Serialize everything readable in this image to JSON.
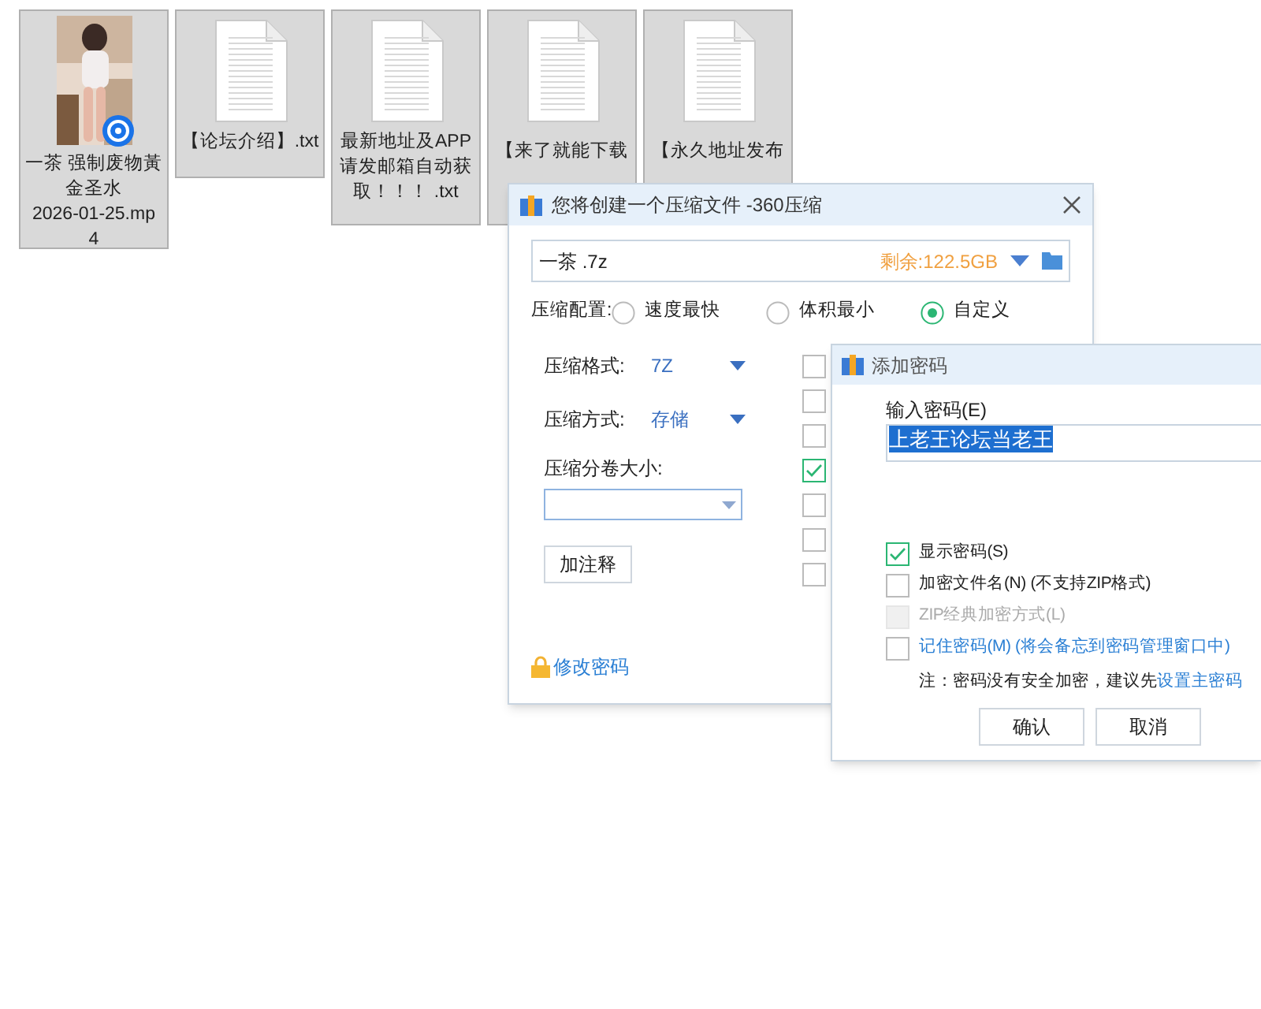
{
  "files": [
    {
      "kind": "video",
      "selected": true,
      "name_lines": [
        "一茶 强制废物黃",
        "金圣水",
        "2026-01-25.mp",
        "4"
      ]
    },
    {
      "kind": "text",
      "selected": true,
      "name_lines": [
        "【论坛介绍】.txt"
      ]
    },
    {
      "kind": "text",
      "selected": true,
      "name_lines": [
        "最新地址及APP",
        "请发邮箱自动获",
        "取！！！ .txt"
      ]
    },
    {
      "kind": "text",
      "selected": true,
      "name_lines": [
        "【来了就能下载"
      ]
    },
    {
      "kind": "text",
      "selected": true,
      "name_lines": [
        "【永久地址发布"
      ]
    }
  ],
  "compress_dialog": {
    "title": "您将创建一个压缩文件 -360压缩",
    "filename": "一茶 .7z",
    "free_space": "剩余:122.5GB",
    "config_label": "压缩配置:",
    "presets": [
      {
        "label": "速度最快",
        "selected": false
      },
      {
        "label": "体积最小",
        "selected": false
      },
      {
        "label": "自定义",
        "selected": true
      }
    ],
    "format_label": "压缩格式:",
    "format": "7Z",
    "method_label": "压缩方式:",
    "method": "存储",
    "volume_label": "压缩分卷大小:",
    "comment_button": "加注释",
    "options": [
      {
        "checked": false
      },
      {
        "checked": false
      },
      {
        "checked": false
      },
      {
        "checked": true
      },
      {
        "checked": false
      },
      {
        "checked": false
      },
      {
        "checked": false
      }
    ],
    "change_password_link": "修改密码"
  },
  "password_dialog": {
    "title": "添加密码",
    "input_label": "输入密码(E)",
    "password": "上老王论坛当老王",
    "options": [
      {
        "kind": "plain",
        "label": "显示密码(S)",
        "checked": true,
        "disabled": false
      },
      {
        "kind": "plain",
        "label": "加密文件名(N) (不支持ZIP格式)",
        "checked": false,
        "disabled": false
      },
      {
        "kind": "plain",
        "label": "ZIP经典加密方式(L)",
        "checked": false,
        "disabled": true
      },
      {
        "kind": "link",
        "label": "记住密码(M) (将会备忘到密码管理窗口中)",
        "checked": false,
        "disabled": false
      }
    ],
    "note": "注：密码没有安全加密，建议先",
    "note_link": "设置主密码",
    "buttons": [
      "确认",
      "取消"
    ]
  }
}
